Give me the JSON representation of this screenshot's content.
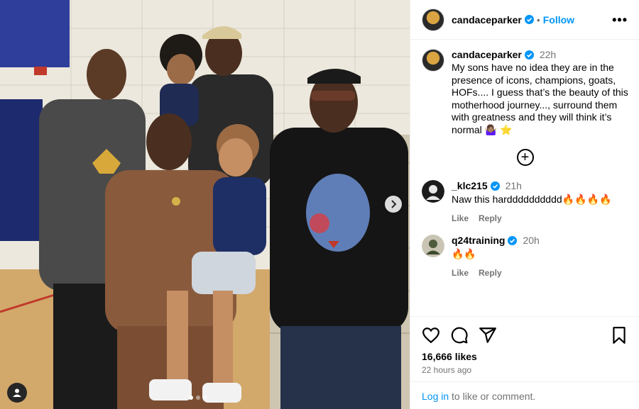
{
  "post": {
    "author": "candaceparker",
    "follow_label": "Follow",
    "separator": "•",
    "more_label": "•••",
    "caption_time": "22h",
    "caption": "My sons have no idea they are in the presence of icons, champions, goats, HOFs.... I guess that’s the beauty of this motherhood journey..., surround them with greatness and they will think it’s normal 🤷🏽‍♀️ ⭐",
    "load_more": "+",
    "likes": "16,666 likes",
    "posted_ago": "22 hours ago",
    "image_slide": {
      "index": 1,
      "total": 3
    }
  },
  "comments": [
    {
      "username": "_klc215",
      "time": "21h",
      "text": "Naw this hardddddddddd🔥🔥🔥🔥",
      "like_label": "Like",
      "reply_label": "Reply",
      "avatar_icon": "user-avatar-icon"
    },
    {
      "username": "q24training",
      "time": "20h",
      "text": "🔥🔥",
      "like_label": "Like",
      "reply_label": "Reply",
      "avatar_icon": "user-avatar-icon"
    }
  ],
  "login_bar": {
    "link": "Log in",
    "rest": " to like or comment."
  },
  "icons": {
    "like": "heart-icon",
    "comment": "comment-icon",
    "share": "share-icon",
    "save": "bookmark-icon",
    "verified": "verified-badge-icon",
    "next": "chevron-right-icon",
    "tags": "person-tag-icon"
  },
  "colors": {
    "accent": "#0095f6",
    "muted": "#737373",
    "verified": "#0095f6"
  }
}
